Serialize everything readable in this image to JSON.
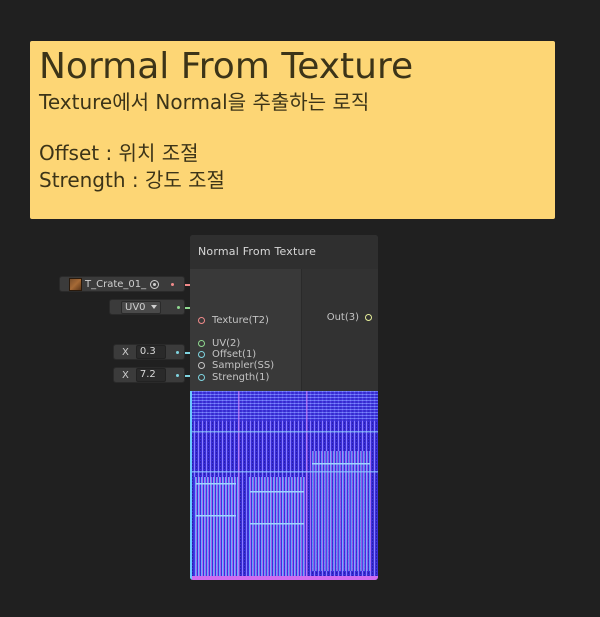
{
  "sticky": {
    "title": "Normal From Texture",
    "line1": "Texture에서 Normal을 추출하는 로직",
    "line2": "Offset : 위치 조절",
    "line3": "Strength : 강도 조절"
  },
  "node": {
    "title": "Normal From Texture",
    "inputs": [
      "Texture(T2)",
      "UV(2)",
      "Sampler(SS)",
      "Offset(1)",
      "Strength(1)"
    ],
    "output": "Out(3)"
  },
  "fields": {
    "texture_name": "T_Crate_01_",
    "uv_channel": "UV0",
    "offset_axis": "X",
    "offset_value": "0.3",
    "strength_axis": "X",
    "strength_value": "7.2"
  },
  "colors": {
    "texture_port": "#f08a8a",
    "uv_port": "#8fd88f",
    "float_port": "#7fd4e0",
    "output_port": "#e6ef9a",
    "sticky_bg": "#fdd675"
  },
  "icons": {
    "texture_thumb": "crate-texture-thumbnail-icon",
    "object_picker": "object-picker-icon",
    "dropdown": "dropdown-arrow-icon"
  }
}
